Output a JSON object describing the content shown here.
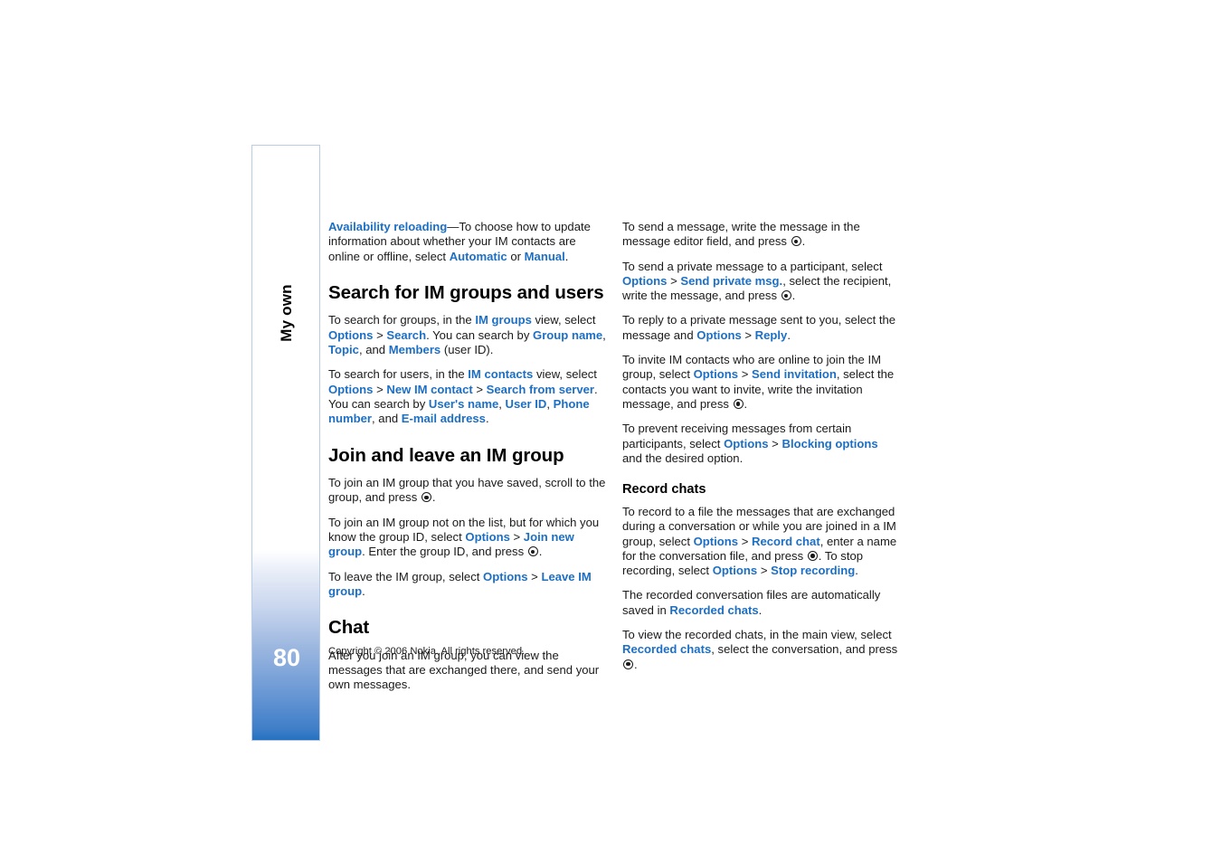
{
  "sidebar": {
    "chapter_label": "My own",
    "page_number": "80"
  },
  "footer": {
    "copyright": "Copyright © 2006 Nokia. All rights reserved."
  },
  "left_column": {
    "availability": {
      "term": "Availability reloading",
      "text_1": "—To choose how to update information about whether your IM contacts are online or offline, select ",
      "link_automatic": "Automatic",
      "text_2": " or ",
      "link_manual": "Manual",
      "text_3": "."
    },
    "heading_search": "Search for IM groups and users",
    "search_groups": {
      "t1": "To search for groups, in the ",
      "l1": "IM groups",
      "t2": " view, select ",
      "l2": "Options",
      "gt1": " > ",
      "l3": "Search",
      "t3": ". You can search by ",
      "l4": "Group name",
      "t4": ", ",
      "l5": "Topic",
      "t5": ", and ",
      "l6": "Members",
      "t6": " (user ID)."
    },
    "search_users": {
      "t1": "To search for users, in the ",
      "l1": "IM contacts",
      "t2": " view, select ",
      "l2": "Options",
      "gt1": " > ",
      "l3": "New IM contact",
      "gt2": " > ",
      "l4": "Search from server",
      "t3": ". You can search by ",
      "l5": "User's name",
      "t4": ", ",
      "l6": "User ID",
      "t5": ", ",
      "l7": "Phone number",
      "t6": ", and ",
      "l8": "E-mail address",
      "t7": "."
    },
    "heading_join": "Join and leave an IM group",
    "join_saved": {
      "t1": "To join an IM group that you have saved, scroll to the group, and press ",
      "t2": "."
    },
    "join_new": {
      "t1": "To join an IM group not on the list, but for which you know the group ID, select ",
      "l1": "Options",
      "gt1": " > ",
      "l2": "Join new group",
      "t2": ". Enter the group ID, and press ",
      "t3": "."
    },
    "leave": {
      "t1": "To leave the IM group, select ",
      "l1": "Options",
      "gt1": " > ",
      "l2": "Leave IM group",
      "t2": "."
    },
    "heading_chat": "Chat",
    "chat_intro": "After you join an IM group, you can view the messages that are exchanged there, and send your own messages."
  },
  "right_column": {
    "send_message": {
      "t1": "To send a message, write the message in the message editor field, and press ",
      "t2": "."
    },
    "send_private": {
      "t1": "To send a private message to a participant, select ",
      "l1": "Options",
      "gt1": " > ",
      "l2": "Send private msg.",
      "t2": ", select the recipient, write the message, and press ",
      "t3": "."
    },
    "reply_private": {
      "t1": "To reply to a private message sent to you, select the message and ",
      "l1": "Options",
      "gt1": " > ",
      "l2": "Reply",
      "t2": "."
    },
    "invite": {
      "t1": "To invite IM contacts who are online to join the IM group, select ",
      "l1": "Options",
      "gt1": " > ",
      "l2": "Send invitation",
      "t2": ", select the contacts you want to invite, write the invitation message, and press ",
      "t3": "."
    },
    "blocking": {
      "t1": "To prevent receiving messages from certain participants, select ",
      "l1": "Options",
      "gt1": " > ",
      "l2": "Blocking options",
      "t2": " and the desired option."
    },
    "heading_record": "Record chats",
    "record": {
      "t1": "To record to a file the messages that are exchanged during a conversation or while you are joined in a IM group, select ",
      "l1": "Options",
      "gt1": " > ",
      "l2": "Record chat",
      "t2": ", enter a name for the conversation file, and press ",
      "t3": ". To stop recording, select ",
      "l3": "Options",
      "gt2": " > ",
      "l4": "Stop recording",
      "t4": "."
    },
    "auto_save": {
      "t1": "The recorded conversation files are automatically saved in ",
      "l1": "Recorded chats",
      "t2": "."
    },
    "view_recorded": {
      "t1": "To view the recorded chats, in the main view, select ",
      "l1": "Recorded chats",
      "t2": ", select the conversation, and press ",
      "t3": "."
    }
  },
  "colors": {
    "link_blue": "#1d6fc4",
    "sidebar_blue": "#2070c0",
    "sidebar_border": "#b9cce4",
    "text": "#1a1a1a"
  }
}
